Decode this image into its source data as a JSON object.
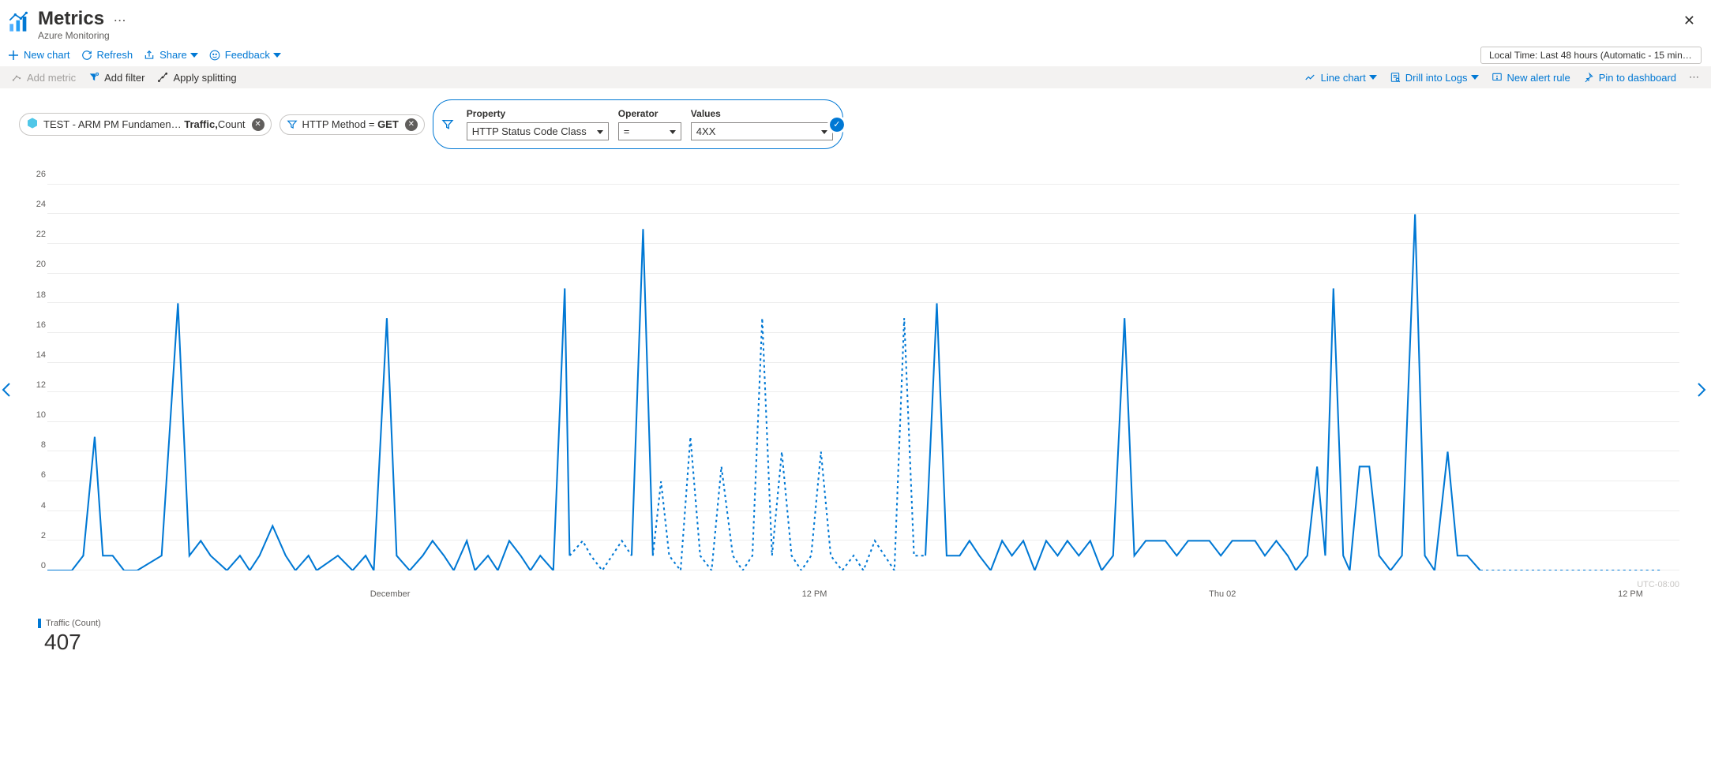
{
  "header": {
    "title": "Metrics",
    "subtitle": "Azure Monitoring"
  },
  "toolbar": {
    "new_chart": "New chart",
    "refresh": "Refresh",
    "share": "Share",
    "feedback": "Feedback",
    "time_range": "Local Time: Last 48 hours (Automatic - 15 minut…"
  },
  "chart_toolbar": {
    "add_metric": "Add metric",
    "add_filter": "Add filter",
    "apply_splitting": "Apply splitting",
    "line_chart": "Line chart",
    "drill": "Drill into Logs",
    "alert": "New alert rule",
    "pin": "Pin to dashboard"
  },
  "chips": {
    "metric_prefix": "TEST - ARM PM Fundamen…",
    "metric_name": "Traffic,",
    "metric_agg": " Count",
    "filter_method": "HTTP Method = ",
    "filter_method_value": "GET"
  },
  "filter_builder": {
    "property_label": "Property",
    "property_value": "HTTP Status Code Class",
    "operator_label": "Operator",
    "operator_value": "=",
    "values_label": "Values",
    "values_value": "4XX"
  },
  "chart_data": {
    "type": "line",
    "ylim": [
      0,
      27
    ],
    "y_ticks": [
      0,
      2,
      4,
      6,
      8,
      10,
      12,
      14,
      16,
      18,
      20,
      22,
      24,
      26
    ],
    "x_labels": [
      {
        "pos": 0.21,
        "text": "December"
      },
      {
        "pos": 0.47,
        "text": "12 PM"
      },
      {
        "pos": 0.72,
        "text": "Thu 02"
      },
      {
        "pos": 0.97,
        "text": "12 PM"
      }
    ],
    "utc_label": "UTC-08:00",
    "series": [
      {
        "name": "Traffic (Count)",
        "solid_segments": [
          [
            [
              0.0,
              0
            ],
            [
              0.015,
              0
            ]
          ],
          [
            [
              0.015,
              0
            ],
            [
              0.022,
              1
            ],
            [
              0.029,
              9
            ],
            [
              0.034,
              1
            ],
            [
              0.04,
              1
            ],
            [
              0.047,
              0
            ],
            [
              0.055,
              0
            ]
          ],
          [
            [
              0.055,
              0
            ],
            [
              0.07,
              1
            ],
            [
              0.08,
              18
            ],
            [
              0.087,
              1
            ],
            [
              0.094,
              2
            ],
            [
              0.1,
              1
            ],
            [
              0.11,
              0
            ],
            [
              0.118,
              1
            ],
            [
              0.124,
              0
            ],
            [
              0.13,
              1
            ],
            [
              0.138,
              3
            ],
            [
              0.146,
              1
            ],
            [
              0.152,
              0
            ],
            [
              0.16,
              1
            ],
            [
              0.165,
              0
            ]
          ],
          [
            [
              0.165,
              0
            ],
            [
              0.178,
              1
            ],
            [
              0.187,
              0
            ],
            [
              0.195,
              1
            ],
            [
              0.2,
              0
            ],
            [
              0.208,
              17
            ],
            [
              0.214,
              1
            ],
            [
              0.222,
              0
            ],
            [
              0.23,
              1
            ],
            [
              0.236,
              2
            ],
            [
              0.243,
              1
            ],
            [
              0.249,
              0
            ],
            [
              0.257,
              2
            ],
            [
              0.262,
              0
            ],
            [
              0.27,
              1
            ],
            [
              0.276,
              0
            ],
            [
              0.283,
              2
            ],
            [
              0.29,
              1
            ],
            [
              0.296,
              0
            ],
            [
              0.302,
              1
            ],
            [
              0.31,
              0
            ],
            [
              0.317,
              19
            ],
            [
              0.32,
              1
            ]
          ],
          [
            [
              0.358,
              1
            ],
            [
              0.365,
              23
            ],
            [
              0.371,
              1
            ]
          ],
          [
            [
              0.538,
              1
            ],
            [
              0.545,
              18
            ],
            [
              0.551,
              1
            ],
            [
              0.559,
              1
            ],
            [
              0.565,
              2
            ],
            [
              0.571,
              1
            ],
            [
              0.578,
              0
            ],
            [
              0.585,
              2
            ],
            [
              0.591,
              1
            ],
            [
              0.598,
              2
            ],
            [
              0.605,
              0
            ],
            [
              0.612,
              2
            ],
            [
              0.619,
              1
            ],
            [
              0.625,
              2
            ],
            [
              0.632,
              1
            ],
            [
              0.639,
              2
            ],
            [
              0.646,
              0
            ],
            [
              0.653,
              1
            ],
            [
              0.66,
              17
            ],
            [
              0.666,
              1
            ],
            [
              0.673,
              2
            ],
            [
              0.679,
              2
            ],
            [
              0.685,
              2
            ],
            [
              0.692,
              1
            ],
            [
              0.699,
              2
            ],
            [
              0.706,
              2
            ],
            [
              0.712,
              2
            ],
            [
              0.719,
              1
            ],
            [
              0.726,
              2
            ],
            [
              0.733,
              2
            ],
            [
              0.74,
              2
            ],
            [
              0.746,
              1
            ],
            [
              0.753,
              2
            ],
            [
              0.76,
              1
            ],
            [
              0.765,
              0
            ],
            [
              0.772,
              1
            ],
            [
              0.778,
              7
            ],
            [
              0.783,
              1
            ],
            [
              0.788,
              19
            ],
            [
              0.794,
              1
            ],
            [
              0.798,
              0
            ],
            [
              0.804,
              7
            ],
            [
              0.81,
              7
            ],
            [
              0.816,
              1
            ],
            [
              0.823,
              0
            ],
            [
              0.83,
              1
            ],
            [
              0.838,
              24
            ],
            [
              0.844,
              1
            ],
            [
              0.85,
              0
            ],
            [
              0.858,
              8
            ],
            [
              0.864,
              1
            ],
            [
              0.87,
              1
            ],
            [
              0.878,
              0
            ]
          ]
        ],
        "dotted_segments": [
          [
            [
              0.32,
              1
            ],
            [
              0.328,
              2
            ],
            [
              0.333,
              1
            ],
            [
              0.34,
              0
            ],
            [
              0.346,
              1
            ],
            [
              0.352,
              2
            ],
            [
              0.358,
              1
            ]
          ],
          [
            [
              0.371,
              1
            ],
            [
              0.376,
              6
            ],
            [
              0.381,
              1
            ],
            [
              0.388,
              0
            ],
            [
              0.394,
              9
            ],
            [
              0.4,
              1
            ],
            [
              0.407,
              0
            ],
            [
              0.413,
              7
            ],
            [
              0.42,
              1
            ],
            [
              0.426,
              0
            ],
            [
              0.432,
              1
            ],
            [
              0.438,
              17
            ],
            [
              0.444,
              1
            ],
            [
              0.45,
              8
            ],
            [
              0.456,
              1
            ],
            [
              0.462,
              0
            ],
            [
              0.468,
              1
            ],
            [
              0.474,
              8
            ],
            [
              0.48,
              1
            ],
            [
              0.487,
              0
            ],
            [
              0.494,
              1
            ],
            [
              0.5,
              0
            ],
            [
              0.507,
              2
            ],
            [
              0.513,
              1
            ],
            [
              0.519,
              0
            ],
            [
              0.525,
              17
            ],
            [
              0.531,
              1
            ],
            [
              0.538,
              1
            ]
          ],
          [
            [
              0.878,
              0
            ],
            [
              0.99,
              0
            ]
          ]
        ]
      }
    ],
    "summary_value": "407"
  }
}
